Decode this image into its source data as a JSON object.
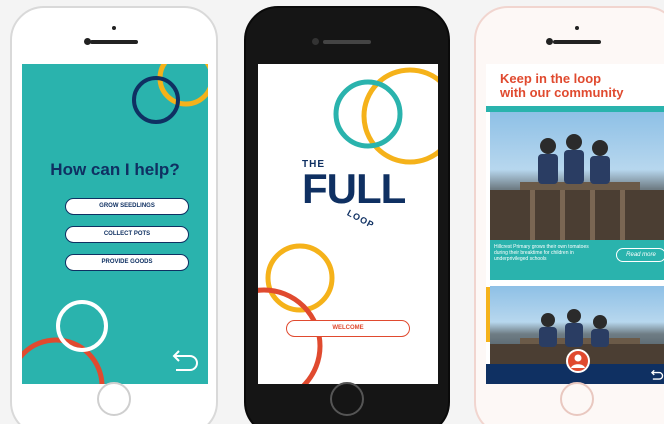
{
  "colors": {
    "teal": "#2ab3ad",
    "navy": "#0f3062",
    "yellow": "#f5b21a",
    "red": "#e04a2f",
    "white": "#ffffff"
  },
  "phone1": {
    "title": "How can I help?",
    "options": [
      {
        "label": "GROW SEEDLINGS"
      },
      {
        "label": "COLLECT POTS"
      },
      {
        "label": "PROVIDE GOODS"
      }
    ],
    "back_icon": "back-arrow-icon"
  },
  "phone2": {
    "logo": {
      "the": "THE",
      "full": "FULL",
      "loop": "LOOP"
    },
    "welcome_label": "WELCOME"
  },
  "phone3": {
    "title_line1": "Keep in the loop",
    "title_line2": "with our community",
    "card": {
      "caption": "Hillcrest Primary grows their own tomatoes during their breaktime for children in underprivileged schools",
      "read_more": "Read more"
    },
    "avatar_icon": "user-icon",
    "back_icon": "back-arrow-icon"
  }
}
